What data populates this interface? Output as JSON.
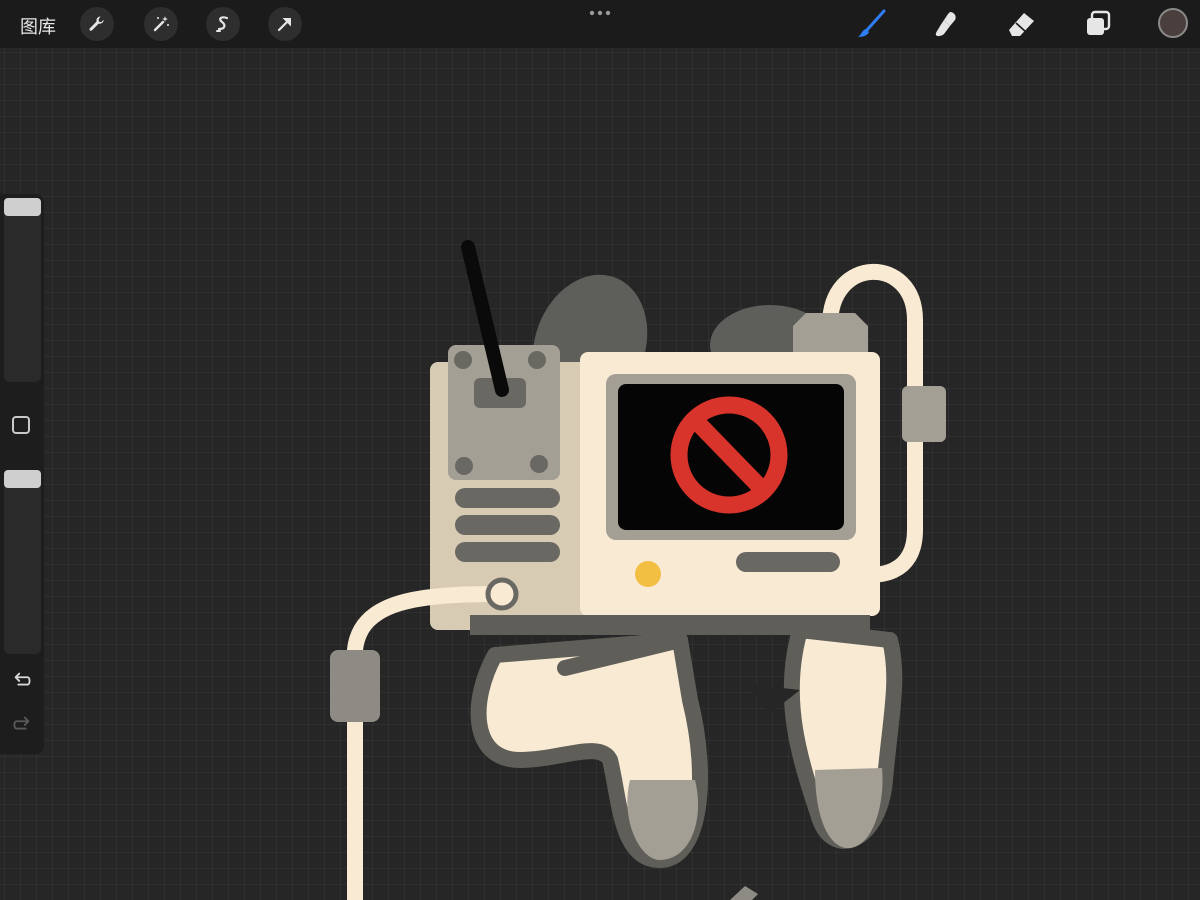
{
  "topbar": {
    "gallery_label": "图库",
    "left_tools": [
      {
        "name": "actions",
        "icon": "wrench-icon"
      },
      {
        "name": "adjustments",
        "icon": "magic-wand-icon"
      },
      {
        "name": "selection",
        "icon": "selection-s-icon"
      },
      {
        "name": "transform",
        "icon": "arrow-cursor-icon"
      }
    ],
    "right_tools": [
      {
        "name": "brush",
        "icon": "brush-icon",
        "active": true
      },
      {
        "name": "smudge",
        "icon": "smudge-icon",
        "active": false
      },
      {
        "name": "eraser",
        "icon": "eraser-icon",
        "active": false
      },
      {
        "name": "layers",
        "icon": "layers-icon",
        "active": false
      }
    ],
    "current_color": "#4a3f3c",
    "active_tool_color": "#2f7df6"
  },
  "sidebar": {
    "brush_size": 1.0,
    "opacity": 1.0,
    "tools": [
      "modify-button",
      "undo-icon",
      "redo-icon"
    ]
  },
  "artwork": {
    "screen_symbol_color": "#d9342b",
    "body_color": "#f8ead3",
    "outline_color": "#5f5e59",
    "accent_color": "#f2bf42"
  }
}
